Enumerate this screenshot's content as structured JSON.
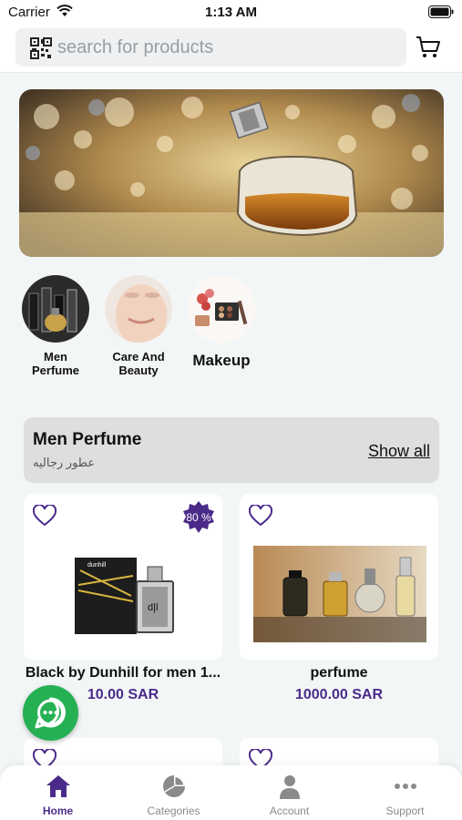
{
  "status_bar": {
    "carrier": "Carrier",
    "time": "1:13 AM"
  },
  "search": {
    "placeholder": "search for products"
  },
  "categories": [
    {
      "label_line1": "Men",
      "label_line2": "Perfume"
    },
    {
      "label_line1": "Care And",
      "label_line2": "Beauty"
    },
    {
      "label": "Makeup"
    }
  ],
  "section": {
    "title": "Men Perfume",
    "subtitle_ar": "عطور رجاليه",
    "show_all": "Show all"
  },
  "products": [
    {
      "name": "Black by Dunhill for men 1...",
      "price": "10.00 SAR",
      "discount": "80 %"
    },
    {
      "name": "perfume",
      "price": "1000.00 SAR"
    }
  ],
  "tabs": [
    {
      "label": "Home",
      "icon": "home-icon",
      "active": true
    },
    {
      "label": "Categories",
      "icon": "pie-chart-icon"
    },
    {
      "label": "Account",
      "icon": "person-icon"
    },
    {
      "label": "Support",
      "icon": "more-dots-icon"
    }
  ],
  "colors": {
    "accent": "#4b2b8a",
    "whatsapp": "#25b153",
    "background": "#f3f6f7"
  }
}
